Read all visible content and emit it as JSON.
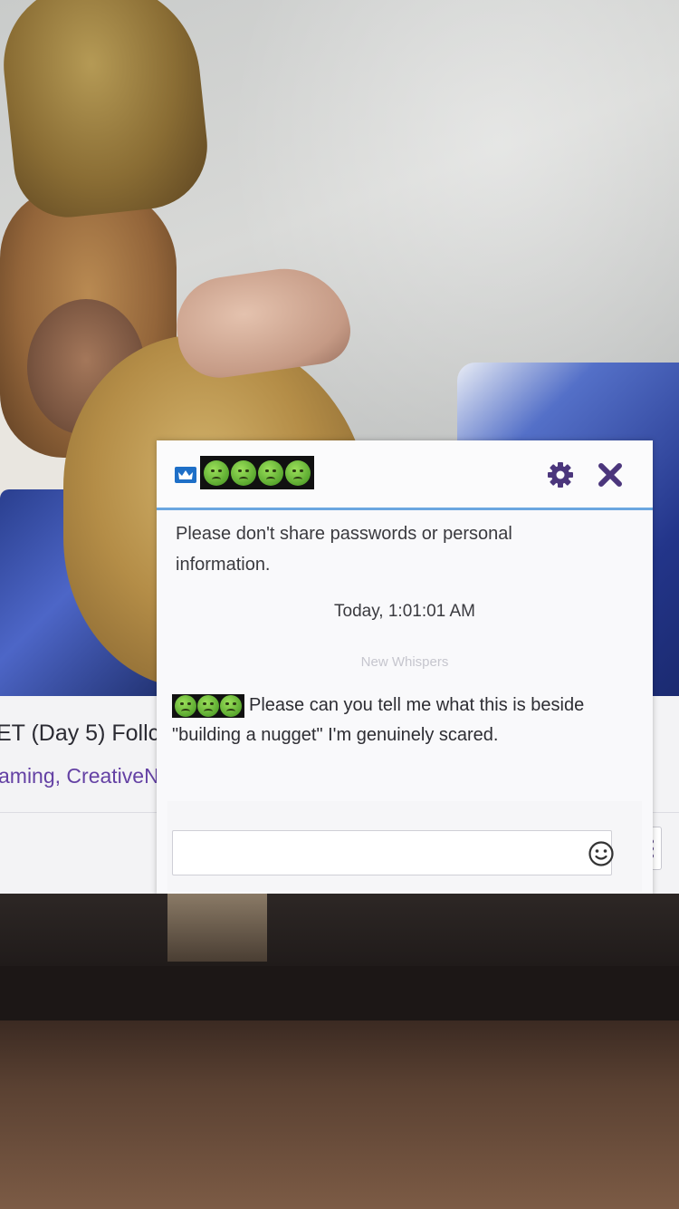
{
  "whisper": {
    "icons": [
      "crown-icon",
      "gear-icon",
      "close-icon",
      "emote-smiley-icon"
    ],
    "notice": "Please don't share passwords or personal information.",
    "timestamp": "Today, 1:01:01 AM",
    "new_whispers_label": "New Whispers",
    "message_text": "Please can you tell me what this is beside \"building a nugget\" I'm genuinely scared.",
    "input_value": "",
    "input_placeholder": ""
  },
  "page": {
    "stream_title_fragment": "ET (Day 5) Follc",
    "stream_tags_fragment": "aming, CreativeN"
  },
  "colors": {
    "accent_purple": "#4b367c",
    "tag_purple": "#6441a4",
    "header_rule_blue": "#6aa6e0",
    "badge_blue": "#1e6fc7"
  }
}
